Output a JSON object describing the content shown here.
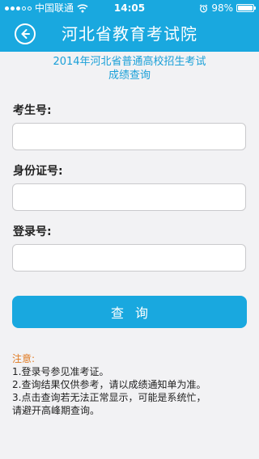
{
  "status_bar": {
    "carrier": "中国联通",
    "time": "14:05",
    "battery_percent": "98%",
    "battery_level": 0.98,
    "icons": [
      "signal-icon",
      "wifi-icon",
      "alarm-icon",
      "battery-icon"
    ]
  },
  "nav": {
    "title": "河北省教育考试院",
    "back_icon": "back-arrow-icon"
  },
  "subtitle": {
    "line1": "2014年河北省普通高校招生考试",
    "line2": "成绩查询"
  },
  "form": {
    "exam_number_label": "考生号:",
    "exam_number_value": "",
    "id_number_label": "身份证号:",
    "id_number_value": "",
    "login_number_label": "登录号:",
    "login_number_value": ""
  },
  "actions": {
    "query_label": "查询"
  },
  "notice": {
    "title": "注意:",
    "lines": [
      "1.登录号参见准考证。",
      "2.查询结果仅供参考，请以成绩通知单为准。",
      "3.点击查询若无法正常显示，可能是系统忙，",
      "请避开高峰期查询。"
    ]
  },
  "colors": {
    "primary": "#19a8df",
    "notice_title": "#e07a22",
    "background": "#f2f2f4"
  }
}
